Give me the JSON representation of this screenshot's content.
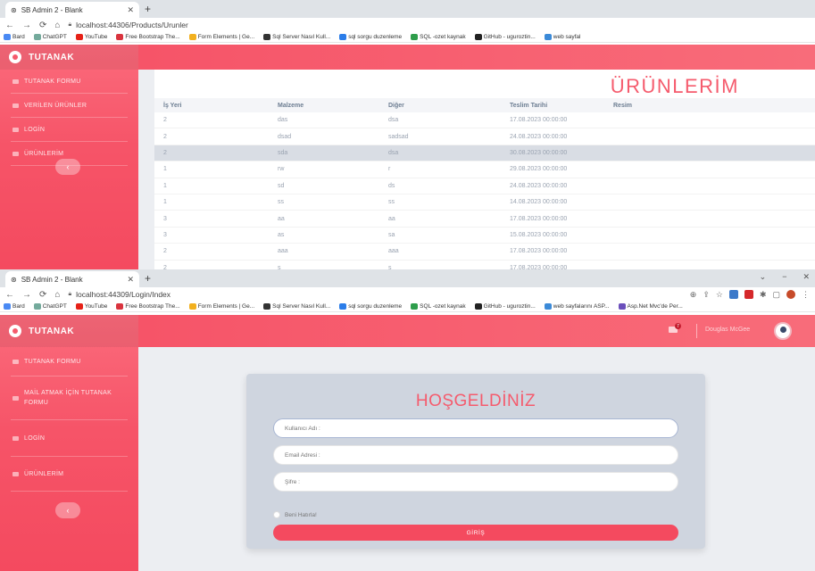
{
  "window1": {
    "tab_title": "SB Admin 2 - Blank",
    "url": "localhost:44306/Products/Urunler",
    "bookmarks": [
      "Bard",
      "ChatGPT",
      "YouTube",
      "Free Bootstrap The...",
      "Form Elements | Ge...",
      "Sql Server Nasıl Kull...",
      "sql sorgu duzenleme",
      "SQL -ozet kaynak",
      "GitHub - uguroztin...",
      "web sayfal"
    ],
    "brand": "TUTANAK",
    "sidebar": [
      "TUTANAK FORMU",
      "VERİLEN ÜRÜNLER",
      "LOGİN",
      "ÜRÜNLERİM"
    ],
    "page_title": "ÜRÜNLERİM",
    "table": {
      "headers": [
        "İş Yeri",
        "Malzeme",
        "Diğer",
        "Teslim Tarihi",
        "Resim"
      ],
      "rows": [
        [
          "2",
          "das",
          "dsa",
          "17.08.2023 00:00:00",
          ""
        ],
        [
          "2",
          "dsad",
          "sadsad",
          "24.08.2023 00:00:00",
          ""
        ],
        [
          "2",
          "sda",
          "dsa",
          "30.08.2023 00:00:00",
          ""
        ],
        [
          "1",
          "rw",
          "r",
          "29.08.2023 00:00:00",
          ""
        ],
        [
          "1",
          "sd",
          "ds",
          "24.08.2023 00:00:00",
          ""
        ],
        [
          "1",
          "ss",
          "ss",
          "14.08.2023 00:00:00",
          ""
        ],
        [
          "3",
          "aa",
          "aa",
          "17.08.2023 00:00:00",
          ""
        ],
        [
          "3",
          "as",
          "sa",
          "15.08.2023 00:00:00",
          ""
        ],
        [
          "2",
          "aaa",
          "aaa",
          "17.08.2023 00:00:00",
          ""
        ],
        [
          "2",
          "s",
          "s",
          "17.08.2023 00:00:00",
          ""
        ]
      ]
    }
  },
  "window2": {
    "tab_title": "SB Admin 2 - Blank",
    "url": "localhost:44309/Login/Index",
    "bookmarks": [
      "Bard",
      "ChatGPT",
      "YouTube",
      "Free Bootstrap The...",
      "Form Elements | Ge...",
      "Sql Server Nasıl Kull...",
      "sql sorgu duzenleme",
      "SQL -ozet kaynak",
      "GitHub - uguroztin...",
      "web sayfalarını ASP...",
      "Asp.Net Mvc'de Per..."
    ],
    "brand": "TUTANAK",
    "sidebar": [
      "TUTANAK FORMU",
      "MAİL ATMAK İÇİN TUTANAK FORMU",
      "LOGİN",
      "ÜRÜNLERİM"
    ],
    "mail_badge": "7",
    "user_name": "Douglas McGee",
    "login": {
      "title": "HOŞGELDİNİZ",
      "username_placeholder": "Kullanıcı Adı :",
      "email_placeholder": "Email Adresi :",
      "password_placeholder": "Şifre :",
      "remember_label": "Beni Hatırla!",
      "submit_label": "GİRİŞ"
    }
  },
  "colors": {
    "accent": "#f55b6d",
    "sidebar": "#f65468",
    "card": "#cfd5df"
  }
}
